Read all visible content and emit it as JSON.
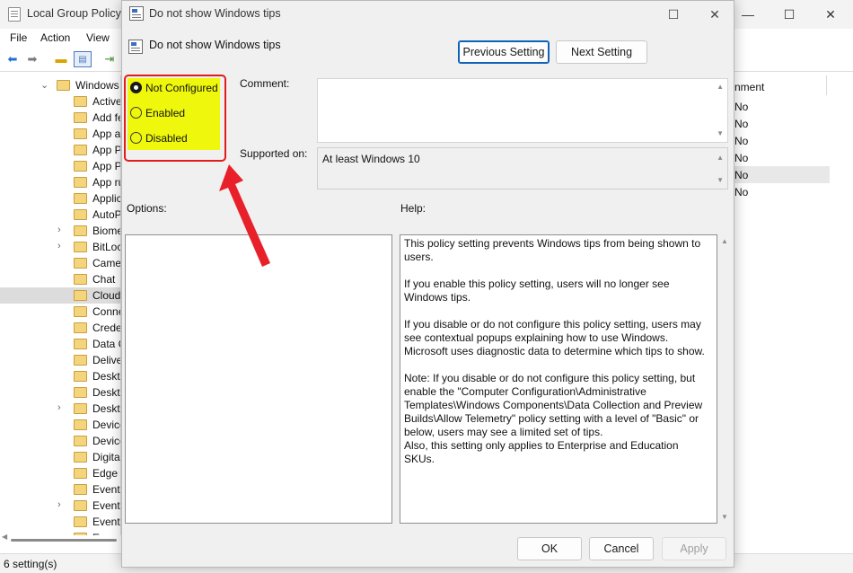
{
  "bg_window": {
    "title": "Local Group Policy E",
    "menu": [
      "File",
      "Action",
      "View"
    ],
    "tree_root": "Windows",
    "tree_items": [
      "Active",
      "Add fe",
      "App a",
      "App P",
      "App P",
      "App ru",
      "Applic",
      "AutoP",
      "Biome",
      "BitLoc",
      "Came",
      "Chat",
      "Cloud",
      "Conne",
      "Crede",
      "Data C",
      "Delive",
      "Deskto",
      "Deskto",
      "Deskto",
      "Device",
      "Device",
      "Digita",
      "Edge U",
      "Event",
      "Event",
      "Event",
      "E"
    ],
    "list_header": "nment",
    "list_values": [
      "No",
      "No",
      "No",
      "No",
      "No",
      "No"
    ],
    "status": "6 setting(s)",
    "controls": {
      "minimize": "—",
      "maximize": "☐",
      "close": "✕"
    }
  },
  "dialog": {
    "title": "Do not show Windows tips",
    "header_title": "Do not show Windows tips",
    "controls": {
      "maximize": "☐",
      "close": "✕"
    },
    "previous_button": "Previous Setting",
    "next_button": "Next Setting",
    "options": {
      "not_configured": "Not Configured",
      "enabled": "Enabled",
      "disabled": "Disabled",
      "selected": "Not Configured"
    },
    "comment_label": "Comment:",
    "comment_value": "",
    "supported_label": "Supported on:",
    "supported_value": "At least Windows 10",
    "options_label": "Options:",
    "help_label": "Help:",
    "help_paragraphs": [
      "This policy setting prevents Windows tips from being shown to users.",
      "If you enable this policy setting, users will no longer see Windows tips.",
      "If you disable or do not configure this policy setting, users may see contextual popups explaining how to use Windows. Microsoft uses diagnostic data to determine which tips to show.",
      "Note: If you disable or do not configure this policy setting, but enable the \"Computer Configuration\\Administrative Templates\\Windows Components\\Data Collection and Preview Builds\\Allow Telemetry\" policy setting with a level of \"Basic\" or below, users may see a limited set of tips.\nAlso, this setting only applies to Enterprise and Education SKUs."
    ],
    "ok_button": "OK",
    "cancel_button": "Cancel",
    "apply_button": "Apply"
  },
  "annotation": {
    "highlight_color": "#eef70c",
    "frame_color": "#e21b1b",
    "arrow_color": "#e8202a"
  }
}
